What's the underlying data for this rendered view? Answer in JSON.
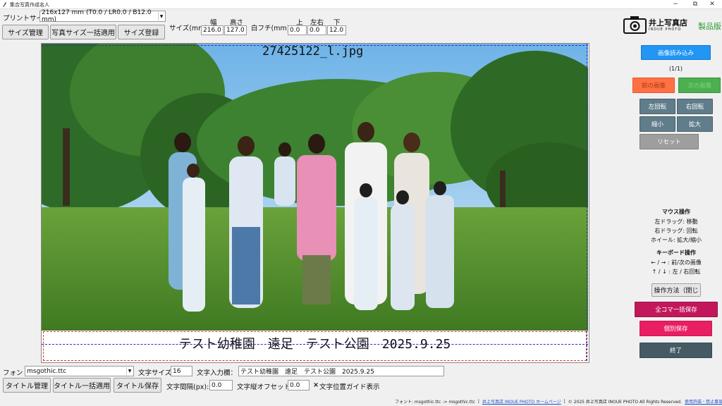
{
  "window": {
    "title": "集合写真作成名人",
    "minimize": "−",
    "maximize": "⧉",
    "close": "✕"
  },
  "toolbar": {
    "print_size_label": "プリントサイズ:",
    "print_size_value": "216x127 mm (T0.0 / LR0.0 / B12.0 mm)",
    "size_label": "サイズ(mm):",
    "width_header": "幅",
    "height_header": "高さ",
    "width_value": "216.0",
    "height_value": "127.0",
    "margin_label": "白フチ(mm):",
    "top_header": "上",
    "lr_header": "左右",
    "bottom_header": "下",
    "top_value": "0.0",
    "lr_value": "0.0",
    "bottom_value": "12.0",
    "size_manage": "サイズ管理",
    "apply_all_size": "写真サイズ一括適用",
    "size_register": "サイズ登録"
  },
  "brand": {
    "logo_text": "井上写真店",
    "logo_sub": "INOUE PHOTO",
    "edition": "製品版"
  },
  "canvas": {
    "filename": "27425122_l.jpg",
    "caption": "テスト幼稚園　遠足　テスト公園　2025.9.25"
  },
  "right_panel": {
    "load_image": "画像読み込み",
    "counter": "(1/1)",
    "prev_image": "前の画像",
    "next_image": "次の画像",
    "rotate_left": "左回転",
    "rotate_right": "右回転",
    "zoom_out": "縮小",
    "zoom_in": "拡大",
    "reset": "リセット",
    "mouse_title": "マウス操作",
    "mouse_lines": [
      "左ドラッグ: 移動",
      "右ドラッグ: 回転",
      "ホイール: 拡大/縮小"
    ],
    "keyboard_title": "キーボード操作",
    "keyboard_lines": [
      "← / → : 前/次の画像",
      "↑ / ↓ : 左 / 右回転"
    ],
    "help_toggle": "操作方法（閉じ",
    "save_all": "全コマ一括保存",
    "save_single": "個別保存",
    "exit": "終了",
    "colors": {
      "blue": "#2196f3",
      "orange": "#ff7043",
      "green": "#4caf50",
      "crimson": "#c2185b",
      "pink": "#e91e63",
      "slate": "#455a64"
    }
  },
  "bottom": {
    "font_label": "フォント:",
    "font_value": "msgothic.ttc",
    "text_size_label": "文字サイズ:",
    "text_size_value": "16",
    "text_input_label": "文字入力欄：",
    "text_input_value": "テスト幼稚園　遠足　テスト公園　2025.9.25",
    "title_manage": "タイトル管理",
    "title_apply_all": "タイトル一括適用",
    "title_save": "タイトル保存",
    "spacing_label": "文字間隔(px):",
    "spacing_value": "0.0",
    "offset_label": "文字縦オフセット:",
    "offset_value": "0.0",
    "guide_check": "×",
    "guide_label": "文字位置ガイド表示"
  },
  "status": {
    "font_info": "フォント: msgothic.ttc -> msgothic.ttc",
    "home_link": "井上写真店 INOUE PHOTO ホームページ",
    "copyright": "© 2025 井上写真店 INOUE PHOTO All Rights Reserved.",
    "terms_link": "使用許諾・禁止事項"
  }
}
